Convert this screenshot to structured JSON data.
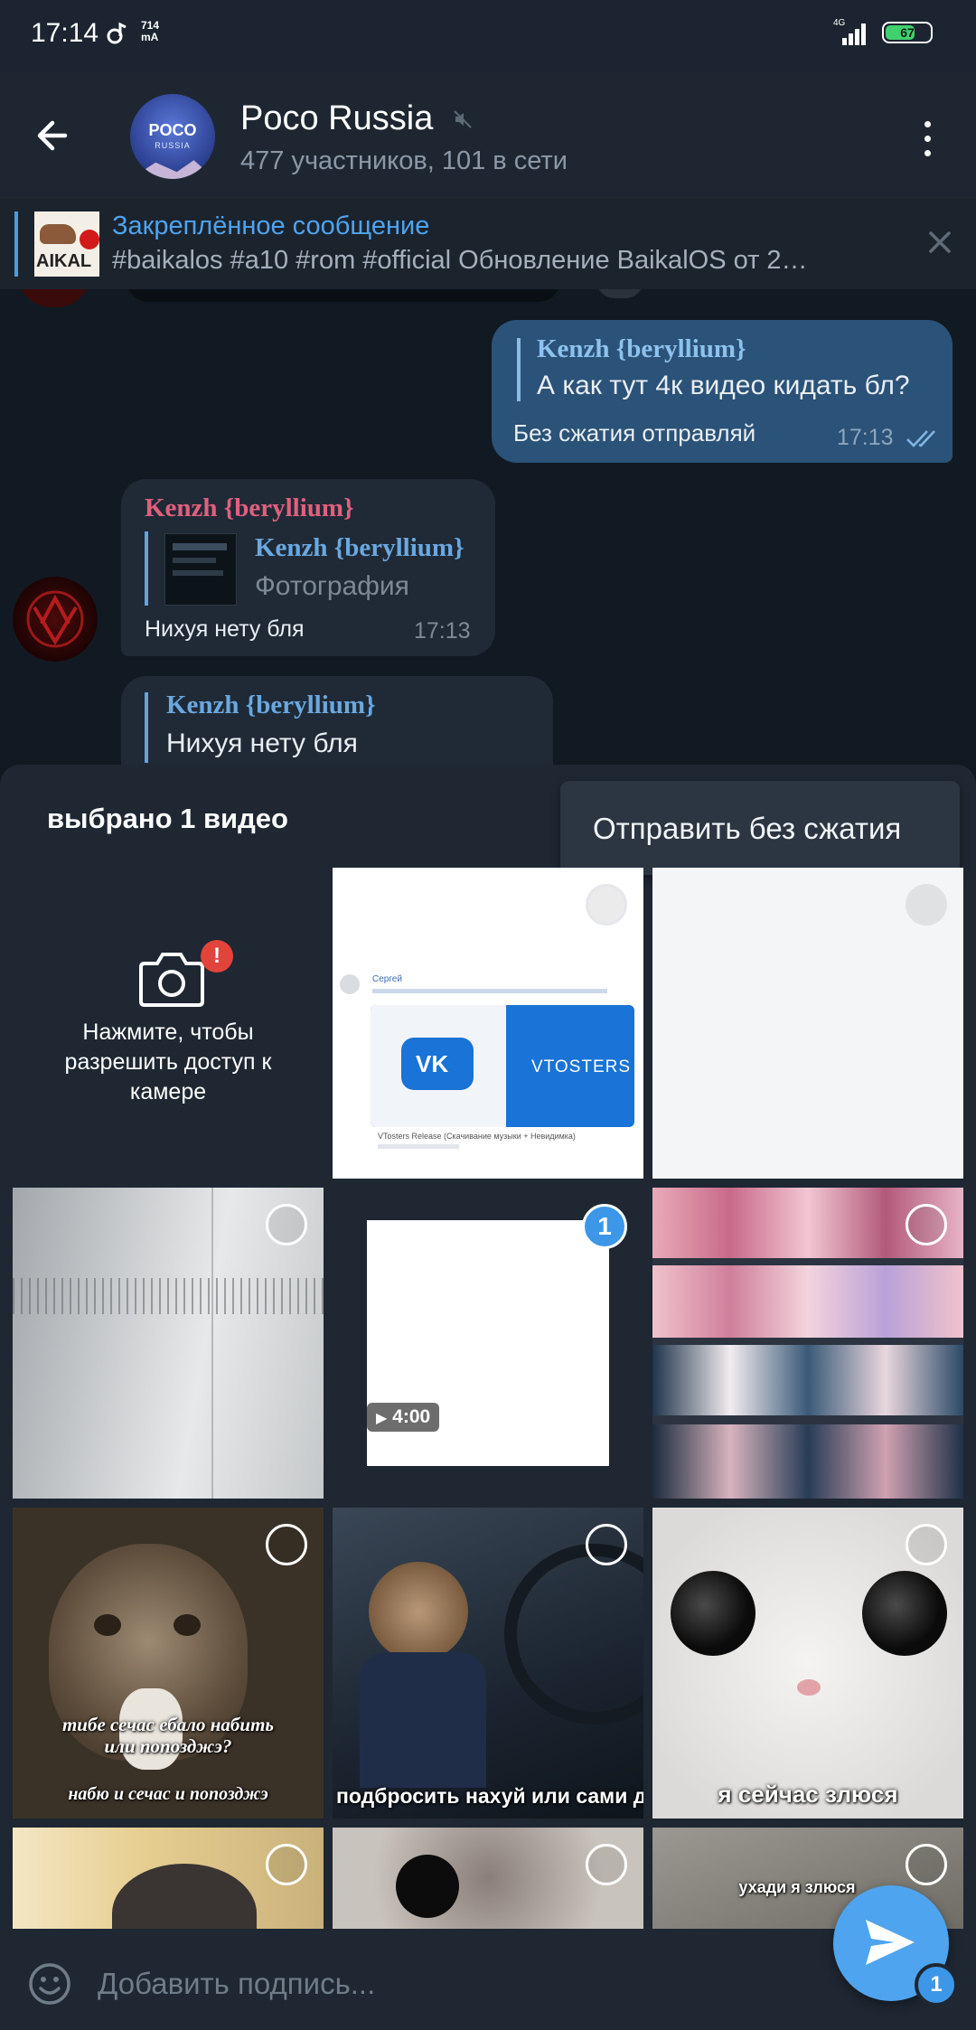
{
  "status_bar": {
    "time": "17:14",
    "data_rate_value": "714",
    "data_rate_unit": "mA",
    "network": "4G",
    "battery": "67"
  },
  "header": {
    "title": "Poco Russia",
    "subtitle": "477 участников, 101 в сети",
    "avatar_line1": "POCO",
    "avatar_line2": "RUSSIA"
  },
  "pinned": {
    "title": "Закреплённое сообщение",
    "text": "#baikalos #a10 #rom #official  Обновление BaikalOS от 2…",
    "thumb_text": "AIKAL"
  },
  "messages": [
    {
      "sender": "Kenzh {beryllium}",
      "quote": "А как тут 4к видео кидать бл?",
      "text": "Без сжатия отправляй",
      "time": "17:13",
      "outgoing": true
    },
    {
      "sender": "Kenzh {beryllium}",
      "reply_sender": "Kenzh {beryllium}",
      "reply_text": "Фотография",
      "text": "Нихуя нету бля",
      "time": "17:13",
      "outgoing": false
    },
    {
      "reply_sender": "Kenzh {beryllium}",
      "reply_text": "Нихуя нету бля",
      "outgoing": false
    }
  ],
  "sheet": {
    "title": "выбрано 1 видео",
    "send_without_compression": "Отправить без сжатия",
    "camera_text": "Нажмите, чтобы разрешить доступ к камере",
    "camera_alert": "!",
    "selected_number": "1",
    "video_duration": "4:00",
    "vk_sender": "Сергей",
    "vk_brand": "VTOSTERS",
    "vk_caption": "VTosters Release (Скачивание музыки + Невидимка)",
    "cat_label_1_line1": "тибе сечас ебало набить",
    "cat_label_1_line2": "или попозджэ?",
    "cat_label_1_bottom": "набю и сечас и попозджэ",
    "cat_label_2": "подбросить нахуй или сами дойд",
    "cat_label_3": "я сейчас злюся",
    "cat_label_4": "ухади я злюся"
  },
  "input": {
    "placeholder": "Добавить подпись..."
  },
  "send": {
    "count": "1"
  },
  "colors": {
    "accent": "#4ea4ee",
    "outgoing_bubble": "#2b5278",
    "incoming_bubble": "#1f2a36",
    "sender_pink": "#e0607e",
    "sender_blue": "#6aa8e0"
  }
}
